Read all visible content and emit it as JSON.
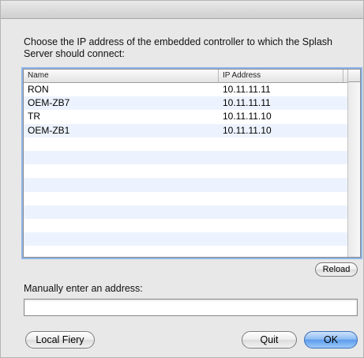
{
  "dialog": {
    "prompt": "Choose the IP address of the embedded controller to which the Splash Server should connect:"
  },
  "table": {
    "columns": {
      "name": "Name",
      "ip": "IP Address"
    },
    "rows": [
      {
        "name": "RON",
        "ip": "10.11.11.11"
      },
      {
        "name": "OEM-ZB7",
        "ip": "10.11.11.11"
      },
      {
        "name": "TR",
        "ip": "10.11.11.10"
      },
      {
        "name": "OEM-ZB1",
        "ip": "10.11.11.10"
      }
    ]
  },
  "buttons": {
    "reload": "Reload",
    "local_fiery": "Local Fiery",
    "quit": "Quit",
    "ok": "OK"
  },
  "manual": {
    "label": "Manually enter an address:",
    "value": "",
    "placeholder": ""
  },
  "colors": {
    "accent": "#5d9cec",
    "row_stripe": "#edf3fe",
    "focus_ring": "#8fb5e8"
  }
}
